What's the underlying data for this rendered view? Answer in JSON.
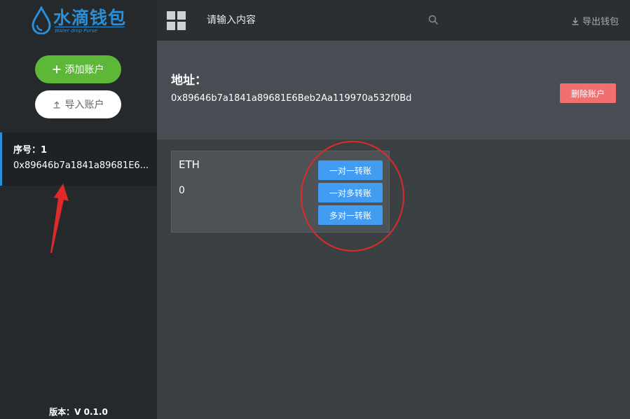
{
  "app": {
    "logo_title": "水滴钱包",
    "logo_subtitle": "Water drop Purse",
    "brand_color": "#2a8fd8"
  },
  "topbar": {
    "search_placeholder": "请输入内容",
    "export_label": "导出钱包",
    "icons": [
      "grid-icon",
      "search-icon",
      "download-icon"
    ]
  },
  "sidebar": {
    "add_account_label": "添加账户",
    "import_account_label": "导入账户",
    "accounts": [
      {
        "index_label": "序号：1",
        "address": "0x89646b7a1841a89681E6..."
      }
    ],
    "version": "版本：V 0.1.0"
  },
  "account_panel": {
    "address_label": "地址：",
    "address": "0x89646b7a1841a89681E6Beb2Aa119970a532f0Bd",
    "delete_label": "删除账户"
  },
  "token": {
    "name": "ETH",
    "balance": "0",
    "actions": [
      "一对一转账",
      "一对多转账",
      "多对一转账"
    ]
  },
  "colors": {
    "green_button": "#5cb836",
    "delete_button": "#f07070",
    "action_button": "#419cf2",
    "annotation_red": "#e02a2a"
  }
}
